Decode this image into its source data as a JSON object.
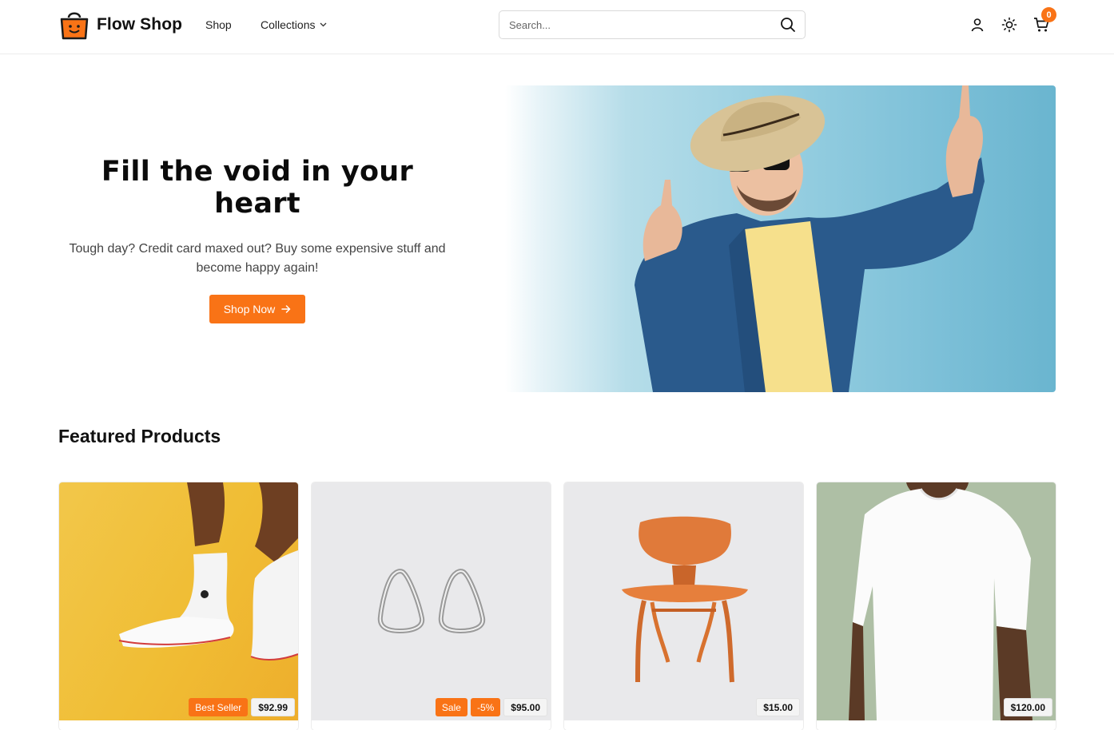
{
  "header": {
    "brand": "Flow Shop",
    "nav": {
      "shop": "Shop",
      "collections": "Collections"
    },
    "search_placeholder": "Search...",
    "cart_count": "0"
  },
  "hero": {
    "title": "Fill the void in your heart",
    "subtitle": "Tough day? Credit card maxed out? Buy some expensive stuff and become happy again!",
    "cta": "Shop Now"
  },
  "featured": {
    "title": "Featured Products",
    "products": [
      {
        "badges": [
          "Best Seller"
        ],
        "price": "$92.99",
        "image": "sneakers"
      },
      {
        "badges": [
          "Sale",
          "-5%"
        ],
        "price": "$95.00",
        "image": "earrings"
      },
      {
        "badges": [],
        "price": "$15.00",
        "image": "chair"
      },
      {
        "badges": [],
        "price": "$120.00",
        "image": "t-shirt"
      }
    ]
  },
  "colors": {
    "accent": "#f97316"
  }
}
